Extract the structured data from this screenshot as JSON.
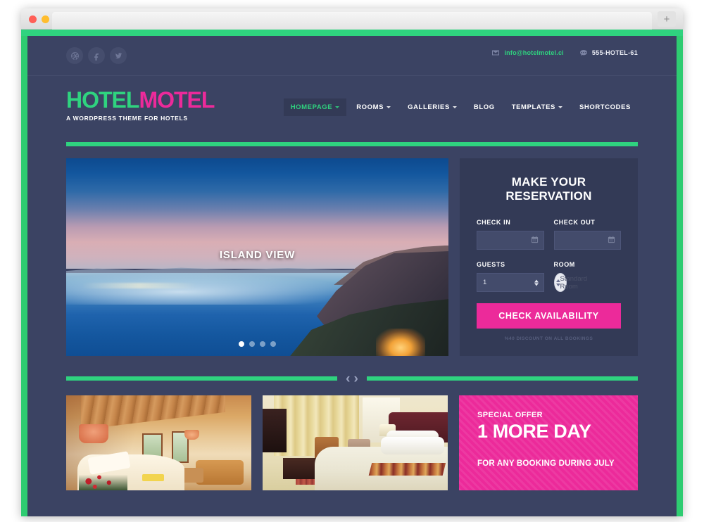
{
  "browser": {
    "new_tab_label": "+",
    "traffic_lights": [
      "close",
      "minimize",
      "maximize"
    ]
  },
  "topbar": {
    "social": [
      {
        "name": "dribbble-icon",
        "label": "Dribbble"
      },
      {
        "name": "facebook-icon",
        "label": "Facebook"
      },
      {
        "name": "twitter-icon",
        "label": "Twitter"
      }
    ],
    "email": "info@hotelmotel.ci",
    "phone": "555-HOTEL-61"
  },
  "header": {
    "logo_first": "HOTEL",
    "logo_second": "MOTEL",
    "tagline": "A WORDPRESS THEME FOR HOTELS",
    "nav": [
      {
        "label": "HOMEPAGE",
        "active": true,
        "dropdown": true
      },
      {
        "label": "ROOMS",
        "active": false,
        "dropdown": true
      },
      {
        "label": "GALLERIES",
        "active": false,
        "dropdown": true
      },
      {
        "label": "BLOG",
        "active": false,
        "dropdown": false
      },
      {
        "label": "TEMPLATES",
        "active": false,
        "dropdown": true
      },
      {
        "label": "SHORTCODES",
        "active": false,
        "dropdown": false
      }
    ]
  },
  "slider": {
    "caption": "ISLAND VIEW",
    "dots": 4,
    "active_dot": 1,
    "prev_label": "‹",
    "next_label": "›"
  },
  "reservation": {
    "title": "MAKE YOUR RESERVATION",
    "check_in": {
      "label": "CHECK IN",
      "value": "",
      "placeholder": "",
      "icon": "calendar-icon"
    },
    "check_out": {
      "label": "CHECK OUT",
      "value": "",
      "placeholder": "",
      "icon": "calendar-icon"
    },
    "guests": {
      "label": "GUESTS",
      "value": "1"
    },
    "room": {
      "label": "ROOM",
      "value": "Standard Room",
      "options": [
        "Standard Room"
      ]
    },
    "submit_label": "CHECK AVAILABILITY",
    "discount_note": "%40 DISCOUNT ON ALL BOOKINGS"
  },
  "cards": {
    "room_photos": [
      {
        "name": "room-photo-attic"
      },
      {
        "name": "room-photo-suite"
      }
    ],
    "offer": {
      "kicker": "SPECIAL OFFER",
      "headline": "1 MORE DAY",
      "sub": "FOR ANY BOOKING DURING JULY"
    }
  },
  "colors": {
    "brand_green": "#2fd37f",
    "brand_pink": "#ec2a9a",
    "page_bg": "#3b4363",
    "panel_bg": "#333a56"
  }
}
